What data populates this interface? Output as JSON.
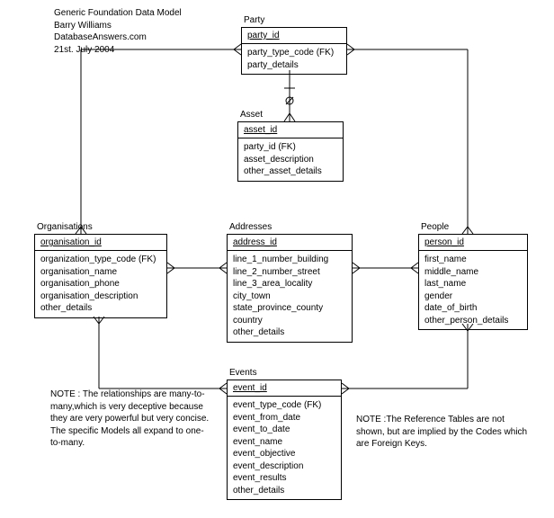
{
  "header": {
    "title": "Generic Foundation Data Model",
    "author": "Barry Williams",
    "site": "DatabaseAnswers.com",
    "date": "21st. July 2004"
  },
  "entities": {
    "party": {
      "title": "Party",
      "key": "party_id",
      "fields": [
        "party_type_code (FK)",
        "party_details"
      ]
    },
    "asset": {
      "title": "Asset",
      "key": "asset_id",
      "fields": [
        "party_id (FK)",
        "asset_description",
        "other_asset_details"
      ]
    },
    "organisations": {
      "title": "Organisations",
      "key": "organisation_id",
      "fields": [
        "organization_type_code (FK)",
        "organisation_name",
        "organisation_phone",
        "organisation_description",
        "other_details"
      ]
    },
    "addresses": {
      "title": "Addresses",
      "key": "address_id",
      "fields": [
        "line_1_number_building",
        "line_2_number_street",
        "line_3_area_locality",
        "city_town",
        "state_province_county",
        "country",
        "other_details"
      ]
    },
    "people": {
      "title": "People",
      "key": "person_id",
      "fields": [
        "first_name",
        "middle_name",
        "last_name",
        "gender",
        "date_of_birth",
        "other_person_details"
      ]
    },
    "events": {
      "title": "Events",
      "key": "event_id",
      "fields": [
        "event_type_code (FK)",
        "event_from_date",
        "event_to_date",
        "event_name",
        "event_objective",
        "event_description",
        "event_results",
        "other_details"
      ]
    }
  },
  "notes": {
    "left": "NOTE : The relationships are many-to-many,which is very deceptive because they are very powerful but very concise. The specific Models all expand to one-to-many.",
    "right": "NOTE :The Reference Tables are not shown, but are implied by the Codes which are Foreign Keys."
  }
}
